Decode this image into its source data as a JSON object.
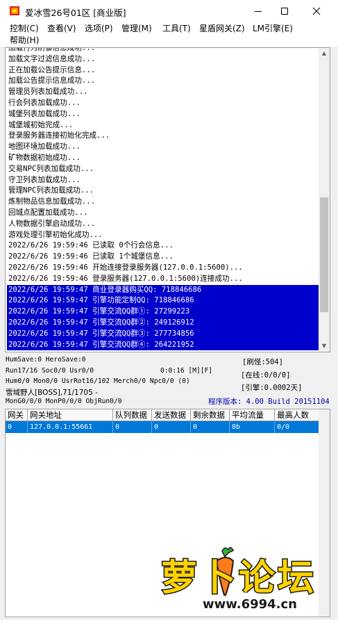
{
  "window": {
    "title": "爱冰雪26号01区 [商业版]",
    "minimize": "—",
    "maximize": "☐",
    "close": "✕"
  },
  "menu": [
    {
      "label": "控制(C)"
    },
    {
      "label": "查看(V)"
    },
    {
      "label": "选项(P)"
    },
    {
      "label": "管理(M)"
    },
    {
      "label": "工具(T)"
    },
    {
      "label": "星盾网关(Z)"
    },
    {
      "label": "LM引擎(E)"
    },
    {
      "label": "帮助(H)"
    }
  ],
  "log": {
    "lines": [
      {
        "text": "加载行为防御信息成功...",
        "sel": false
      },
      {
        "text": "加载文字过滤信息成功...",
        "sel": false
      },
      {
        "text": "正在加载公告提示信息...",
        "sel": false
      },
      {
        "text": "加载公告提示信息成功...",
        "sel": false
      },
      {
        "text": "管理员列表加载成功...",
        "sel": false
      },
      {
        "text": "行会列表加载成功...",
        "sel": false
      },
      {
        "text": "城堡列表加载成功...",
        "sel": false
      },
      {
        "text": "城堡城初始完成...",
        "sel": false
      },
      {
        "text": "登录服务器连接初始化完成...",
        "sel": false
      },
      {
        "text": "地图环境加载成功...",
        "sel": false
      },
      {
        "text": "矿物数据初始成功...",
        "sel": false
      },
      {
        "text": "交易NPC列表加载成功...",
        "sel": false
      },
      {
        "text": "守卫列表加载成功...",
        "sel": false
      },
      {
        "text": "管理NPC列表加载成功...",
        "sel": false
      },
      {
        "text": "炼制物品信息加载成功...",
        "sel": false
      },
      {
        "text": "回城点配置加载成功...",
        "sel": false
      },
      {
        "text": "人物数据引擎启动成功...",
        "sel": false
      },
      {
        "text": "游戏处理引擎初始化成功...",
        "sel": false
      },
      {
        "text": "2022/6/26 19:59:46 已读取 0个行会信息...",
        "sel": false
      },
      {
        "text": "2022/6/26 19:59:46 已读取 1个城堡信息...",
        "sel": false
      },
      {
        "text": "2022/6/26 19:59:46 开始连接登录服务器(127.0.0.1:5600)...",
        "sel": false
      },
      {
        "text": "2022/6/26 19:59:46 登录服务器(127.0.0.1:5600)连接成功...",
        "sel": false
      },
      {
        "text": "2022/6/26 19:59:47 商业登录器购买QQ: 718846686",
        "sel": true
      },
      {
        "text": "2022/6/26 19:59:47 引擎功能定制QQ: 718846686",
        "sel": true
      },
      {
        "text": "2022/6/26 19:59:47 引擎交流QQ群①: 27299223",
        "sel": true
      },
      {
        "text": "2022/6/26 19:59:47 引擎交流QQ群②: 249126912",
        "sel": true
      },
      {
        "text": "2022/6/26 19:59:47 引擎交流QQ群③: 277734856",
        "sel": true
      },
      {
        "text": "2022/6/26 19:59:47 引擎交流QQ群④: 264221952",
        "sel": true
      }
    ],
    "scroll_up": "▲",
    "scroll_down": "▼"
  },
  "status": {
    "line1": "HumSave:0 HeroSave:0",
    "line2": "Run17/16 Soc0/0 Usr0/0",
    "time": "0:0:16 [M][F]",
    "line3": "Hum0/0 Mon0/0 UsrRot16/102 Merch0/0 Npc0/0 (0)",
    "line4": "雪域野人[BOSS],71/1705 -",
    "line5": "MonG0/0/0 MonP0/0/0 ObjRun0/0",
    "refresh": "[刷怪:504]",
    "online": "[在线:0/0/0]",
    "engine": "[引擎:0.0002天]",
    "version": "程序版本: 4.00 Build 20151104"
  },
  "table": {
    "headers": [
      "网关",
      "网关地址",
      "队列数据",
      "发送数据",
      "剩余数据",
      "平均流量",
      "最高人数"
    ],
    "rows": [
      [
        "0",
        "127.0.0.1:55661",
        "0",
        "0",
        "0",
        "0b",
        "0/0"
      ]
    ]
  },
  "watermark": {
    "logo": "萝卜论坛",
    "url": "www.6994.cn"
  },
  "colors": {
    "selection": "#0000cc",
    "row_selected": "#0078d7",
    "version_text": "#0000b0",
    "watermark_orange": "#f26a10",
    "watermark_yellow": "#ffd200"
  }
}
